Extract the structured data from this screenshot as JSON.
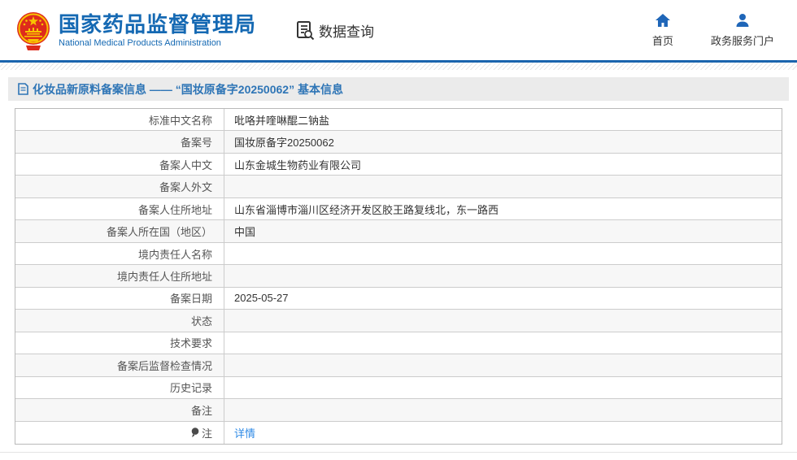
{
  "header": {
    "org_name_cn": "国家药品监督管理局",
    "org_name_en": "National Medical Products Administration",
    "data_query_label": "数据查询",
    "home_label": "首页",
    "portal_label": "政务服务门户"
  },
  "page_title": "化妆品新原料备案信息 —— “国妆原备字20250062” 基本信息",
  "table": {
    "rows": [
      {
        "label": "标准中文名称",
        "value": "吡咯并喹啉醌二钠盐"
      },
      {
        "label": "备案号",
        "value": "国妆原备字20250062"
      },
      {
        "label": "备案人中文",
        "value": "山东金城生物药业有限公司"
      },
      {
        "label": "备案人外文",
        "value": ""
      },
      {
        "label": "备案人住所地址",
        "value": "山东省淄博市淄川区经济开发区胶王路复线北，东一路西"
      },
      {
        "label": "备案人所在国（地区）",
        "value": "中国"
      },
      {
        "label": "境内责任人名称",
        "value": ""
      },
      {
        "label": "境内责任人住所地址",
        "value": ""
      },
      {
        "label": "备案日期",
        "value": "2025-05-27"
      },
      {
        "label": "状态",
        "value": ""
      },
      {
        "label": "技术要求",
        "value": ""
      },
      {
        "label": "备案后监督检查情况",
        "value": ""
      },
      {
        "label": "历史记录",
        "value": ""
      },
      {
        "label": "备注",
        "value": ""
      },
      {
        "label": "注",
        "value": "详情",
        "value_is_link": true,
        "label_icon": "pin-icon"
      }
    ]
  },
  "icons": {
    "emblem": "national-emblem-icon",
    "data_query": "doc-search-icon",
    "home": "home-icon",
    "portal": "user-icon",
    "title": "page-icon",
    "note": "pin-icon"
  },
  "colors": {
    "brand_blue": "#1569b3",
    "rule_blue": "#1a64ad",
    "title_blue": "#2e75b6",
    "link_blue": "#2e8ae6",
    "titlebar_bg": "#ebebeb",
    "row_alt_bg": "#f7f7f7",
    "border_gray": "#cccccc",
    "emblem_red": "#de2b1c",
    "emblem_gold": "#f8c300"
  }
}
